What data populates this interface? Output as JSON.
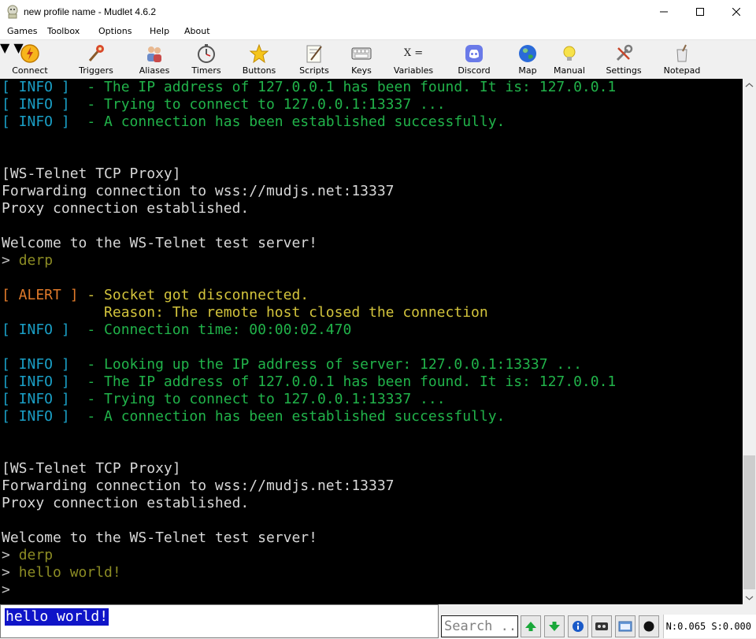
{
  "window": {
    "title": "new profile name - Mudlet 4.6.2"
  },
  "menubar": [
    "Games",
    "Toolbox",
    "Options",
    "Help",
    "About"
  ],
  "toolbar": [
    {
      "label": "Connect",
      "icon": "connect-icon"
    },
    {
      "label": "Triggers",
      "icon": "triggers-icon"
    },
    {
      "label": "Aliases",
      "icon": "aliases-icon"
    },
    {
      "label": "Timers",
      "icon": "timers-icon"
    },
    {
      "label": "Buttons",
      "icon": "buttons-icon"
    },
    {
      "label": "Scripts",
      "icon": "scripts-icon"
    },
    {
      "label": "Keys",
      "icon": "keys-icon"
    },
    {
      "label": "Variables",
      "icon": "variables-icon",
      "glyph": "X ="
    },
    {
      "label": "Discord",
      "icon": "discord-icon"
    },
    {
      "label": "Map",
      "icon": "map-icon"
    },
    {
      "label": "Manual",
      "icon": "manual-icon"
    },
    {
      "label": "Settings",
      "icon": "settings-icon"
    },
    {
      "label": "Notepad",
      "icon": "notepad-icon"
    }
  ],
  "colors": {
    "info_tag": "#1a9fc6",
    "info_text": "#21b34a",
    "alert_tag": "#e07a2a",
    "alert_text": "#d3c43c",
    "plain": "#d8d8d8",
    "echo": "#8c8c24",
    "prompt": "#c0c0c0",
    "cmd_highlight": "#0f14c8"
  },
  "console": {
    "lines": [
      [
        {
          "t": "[ INFO ]",
          "c": "info_tag"
        },
        {
          "t": "  - The IP address of 127.0.0.1 has been found. It is: 127.0.0.1",
          "c": "info_text"
        }
      ],
      [
        {
          "t": "[ INFO ]",
          "c": "info_tag"
        },
        {
          "t": "  - Trying to connect to 127.0.0.1:13337 ...",
          "c": "info_text"
        }
      ],
      [
        {
          "t": "[ INFO ]",
          "c": "info_tag"
        },
        {
          "t": "  - A connection has been established successfully.",
          "c": "info_text"
        }
      ],
      [],
      [],
      [
        {
          "t": "[WS-Telnet TCP Proxy]",
          "c": "plain"
        }
      ],
      [
        {
          "t": "Forwarding connection to wss://mudjs.net:13337",
          "c": "plain"
        }
      ],
      [
        {
          "t": "Proxy connection established.",
          "c": "plain"
        }
      ],
      [],
      [
        {
          "t": "Welcome to the WS-Telnet test server!",
          "c": "plain"
        }
      ],
      [
        {
          "t": "> ",
          "c": "prompt"
        },
        {
          "t": "derp",
          "c": "echo"
        }
      ],
      [],
      [
        {
          "t": "[ ALERT ]",
          "c": "alert_tag"
        },
        {
          "t": " - Socket got disconnected.",
          "c": "alert_text"
        }
      ],
      [
        {
          "t": "            Reason: The remote host closed the connection",
          "c": "alert_text"
        }
      ],
      [
        {
          "t": "[ INFO ]",
          "c": "info_tag"
        },
        {
          "t": "  - Connection time: 00:00:02.470",
          "c": "info_text"
        }
      ],
      [],
      [
        {
          "t": "[ INFO ]",
          "c": "info_tag"
        },
        {
          "t": "  - Looking up the IP address of server: 127.0.0.1:13337 ...",
          "c": "info_text"
        }
      ],
      [
        {
          "t": "[ INFO ]",
          "c": "info_tag"
        },
        {
          "t": "  - The IP address of 127.0.0.1 has been found. It is: 127.0.0.1",
          "c": "info_text"
        }
      ],
      [
        {
          "t": "[ INFO ]",
          "c": "info_tag"
        },
        {
          "t": "  - Trying to connect to 127.0.0.1:13337 ...",
          "c": "info_text"
        }
      ],
      [
        {
          "t": "[ INFO ]",
          "c": "info_tag"
        },
        {
          "t": "  - A connection has been established successfully.",
          "c": "info_text"
        }
      ],
      [],
      [],
      [
        {
          "t": "[WS-Telnet TCP Proxy]",
          "c": "plain"
        }
      ],
      [
        {
          "t": "Forwarding connection to wss://mudjs.net:13337",
          "c": "plain"
        }
      ],
      [
        {
          "t": "Proxy connection established.",
          "c": "plain"
        }
      ],
      [],
      [
        {
          "t": "Welcome to the WS-Telnet test server!",
          "c": "plain"
        }
      ],
      [
        {
          "t": "> ",
          "c": "prompt"
        },
        {
          "t": "derp",
          "c": "echo"
        }
      ],
      [
        {
          "t": "> ",
          "c": "prompt"
        },
        {
          "t": "hello world!",
          "c": "echo"
        }
      ],
      [
        {
          "t": ">",
          "c": "prompt"
        }
      ]
    ]
  },
  "input": {
    "value": "hello world!"
  },
  "search": {
    "placeholder": "Search ..."
  },
  "bottom_buttons": [
    "arrow-up-icon",
    "arrow-down-icon",
    "info-icon",
    "replay-icon",
    "logging-icon",
    "record-icon"
  ],
  "stats": {
    "text": "N:0.065 S:0.000"
  }
}
